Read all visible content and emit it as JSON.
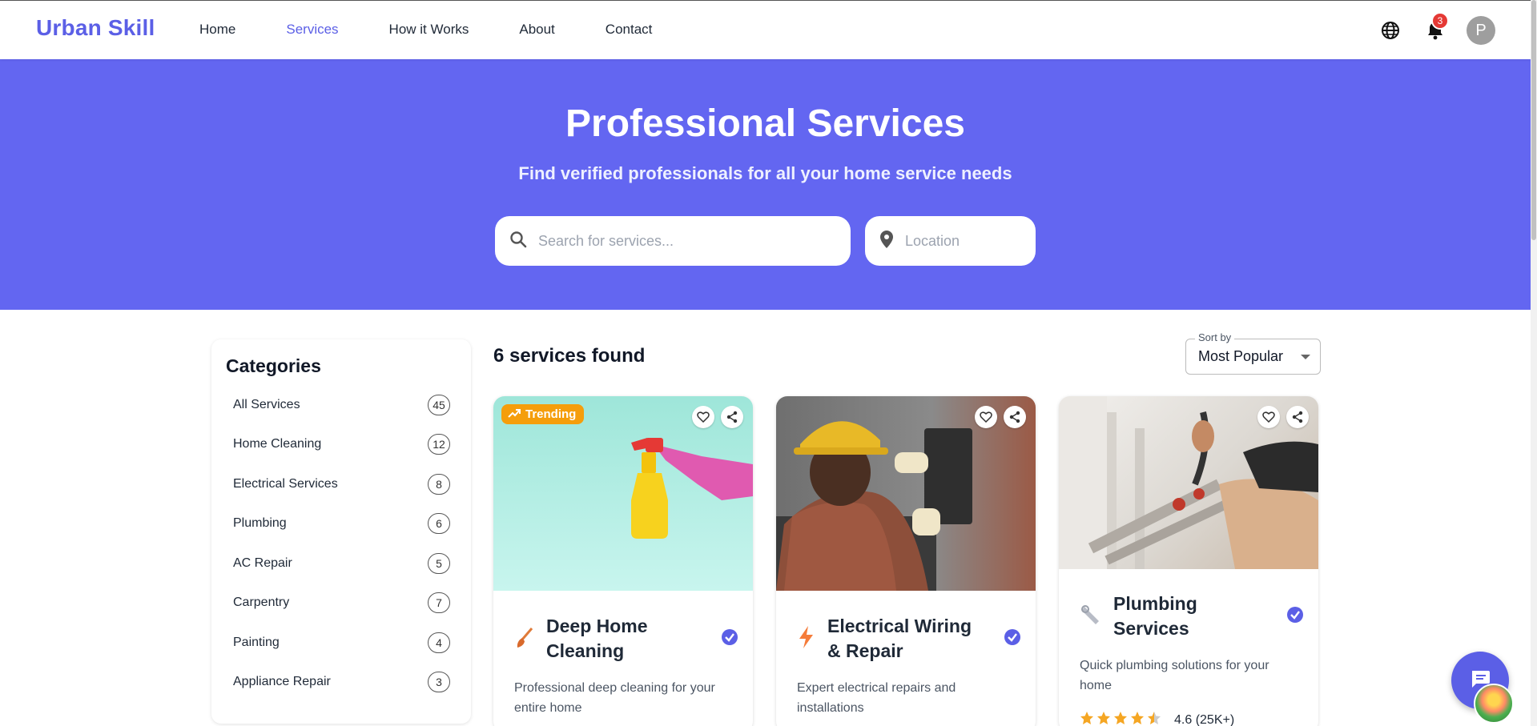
{
  "header": {
    "brand": "Urban Skill",
    "nav": [
      "Home",
      "Services",
      "How it Works",
      "About",
      "Contact"
    ],
    "active_nav": "Services",
    "notification_count": "3",
    "avatar_initial": "P",
    "icons": [
      "globe-icon",
      "bell-icon"
    ]
  },
  "hero": {
    "title": "Professional Services",
    "subtitle": "Find verified professionals for all your home service needs",
    "search_placeholder": "Search for services...",
    "location_placeholder": "Location",
    "background_color": "#6366f1"
  },
  "sidebar": {
    "title": "Categories",
    "items": [
      {
        "label": "All Services",
        "count": "45"
      },
      {
        "label": "Home Cleaning",
        "count": "12"
      },
      {
        "label": "Electrical Services",
        "count": "8"
      },
      {
        "label": "Plumbing",
        "count": "6"
      },
      {
        "label": "AC Repair",
        "count": "5"
      },
      {
        "label": "Carpentry",
        "count": "7"
      },
      {
        "label": "Painting",
        "count": "4"
      },
      {
        "label": "Appliance Repair",
        "count": "3"
      }
    ]
  },
  "results": {
    "count_text": "6 services found",
    "sort_label": "Sort by",
    "sort_value": "Most Popular"
  },
  "cards": [
    {
      "badge": "Trending",
      "title": "Deep Home Cleaning",
      "description": "Professional deep cleaning for your entire home",
      "icon": "brush-icon"
    },
    {
      "title": "Electrical Wiring & Repair",
      "description": "Expert electrical repairs and installations",
      "icon": "bolt-icon"
    },
    {
      "title": "Plumbing Services",
      "description": "Quick plumbing solutions for your home",
      "icon": "wrench-icon",
      "rating": "4.6 (25K+)",
      "stars": 4.5
    }
  ],
  "colors": {
    "accent": "#5b5fe6",
    "trending": "#f59e0b",
    "star": "#f5a623"
  }
}
